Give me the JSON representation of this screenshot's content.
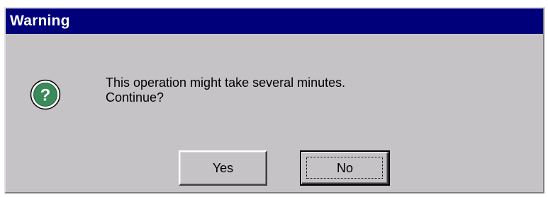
{
  "window": {
    "title": "Warning",
    "titlebar_color": "#00007b",
    "background_color": "#c6c3c6"
  },
  "icon": {
    "name": "question-icon",
    "glyph": "?",
    "color": "#2e8b57"
  },
  "message": {
    "line1": "This operation might take several minutes.",
    "line2": "Continue?"
  },
  "buttons": {
    "yes_label": "Yes",
    "no_label": "No",
    "default_focus": "No"
  }
}
